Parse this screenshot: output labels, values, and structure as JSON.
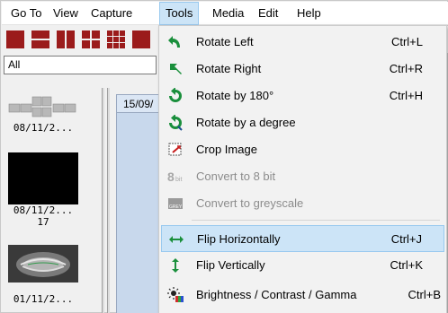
{
  "menubar": {
    "items": [
      {
        "label": "Go To"
      },
      {
        "label": "View"
      },
      {
        "label": "Capture"
      },
      {
        "label": "Tools"
      },
      {
        "label": "Media"
      },
      {
        "label": "Edit"
      },
      {
        "label": "Help"
      }
    ],
    "active": "Tools"
  },
  "toolbar": {
    "buttons": [
      "layout-1x1-icon",
      "layout-2-rows-icon",
      "layout-2-cols-icon",
      "layout-2x2-icon",
      "layout-3x3-icon",
      "layout-4x4-icon"
    ]
  },
  "filter": {
    "value": "All"
  },
  "thumbnails": [
    {
      "date": "08/11/2...",
      "extra": ""
    },
    {
      "date": "08/11/2...",
      "extra": "17"
    },
    {
      "date": "01/11/2...",
      "extra": ""
    }
  ],
  "viewer": {
    "tab_label": "15/09/"
  },
  "tools_menu": {
    "items": [
      {
        "label": "Rotate Left",
        "shortcut": "Ctrl+L",
        "icon": "rotate-left-icon",
        "enabled": true
      },
      {
        "label": "Rotate Right",
        "shortcut": "Ctrl+R",
        "icon": "rotate-right-icon",
        "enabled": true
      },
      {
        "label": "Rotate by 180°",
        "shortcut": "Ctrl+H",
        "icon": "rotate-180-icon",
        "enabled": true
      },
      {
        "label": "Rotate by a degree",
        "shortcut": "",
        "icon": "rotate-degree-icon",
        "enabled": true
      },
      {
        "label": "Crop Image",
        "shortcut": "",
        "icon": "crop-icon",
        "enabled": true
      },
      {
        "label": "Convert to 8 bit",
        "shortcut": "",
        "icon": "8bit-icon",
        "enabled": false
      },
      {
        "label": "Convert to greyscale",
        "shortcut": "",
        "icon": "greyscale-icon",
        "enabled": false
      },
      {
        "label": "Flip Horizontally",
        "shortcut": "Ctrl+J",
        "icon": "flip-horizontal-icon",
        "enabled": true
      },
      {
        "label": "Flip Vertically",
        "shortcut": "Ctrl+K",
        "icon": "flip-vertical-icon",
        "enabled": true
      },
      {
        "label": "Brightness / Contrast / Gamma",
        "shortcut": "Ctrl+B",
        "icon": "brightness-contrast-icon",
        "enabled": true
      }
    ],
    "icon_texts": {
      "bit_big": "8",
      "bit_small": "bit",
      "grey": "GREY"
    },
    "hovered": "Flip Horizontally"
  },
  "colors": {
    "accent_green": "#1a8f3c",
    "toolbar_red": "#9b1b1b",
    "hover_bg": "#cce4f7",
    "disabled_text": "#8c8c8c"
  }
}
